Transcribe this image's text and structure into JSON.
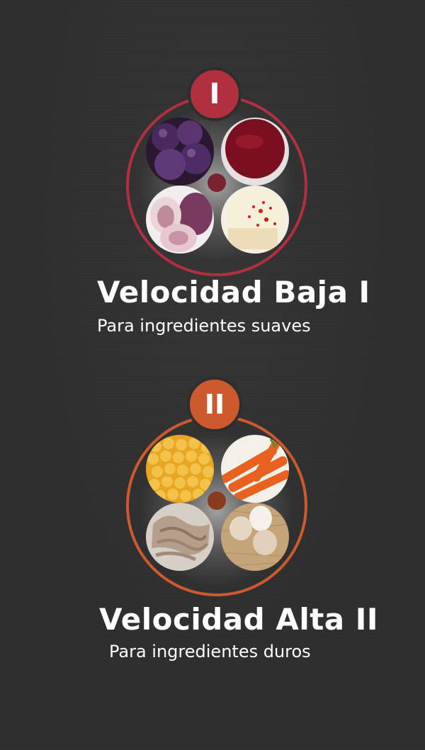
{
  "low_speed": {
    "badge": "I",
    "title": "Velocidad Baja I",
    "subtitle": "Para ingredientes suaves",
    "accent_color": "#b03040",
    "foods": [
      "plums",
      "fruit-puree",
      "figs",
      "cream-dessert"
    ]
  },
  "high_speed": {
    "badge": "II",
    "title": "Velocidad Alta II",
    "subtitle": "Para ingredientes duros",
    "accent_color": "#cc5a2e",
    "foods": [
      "chickpeas",
      "carrots",
      "meat",
      "eggs"
    ]
  }
}
